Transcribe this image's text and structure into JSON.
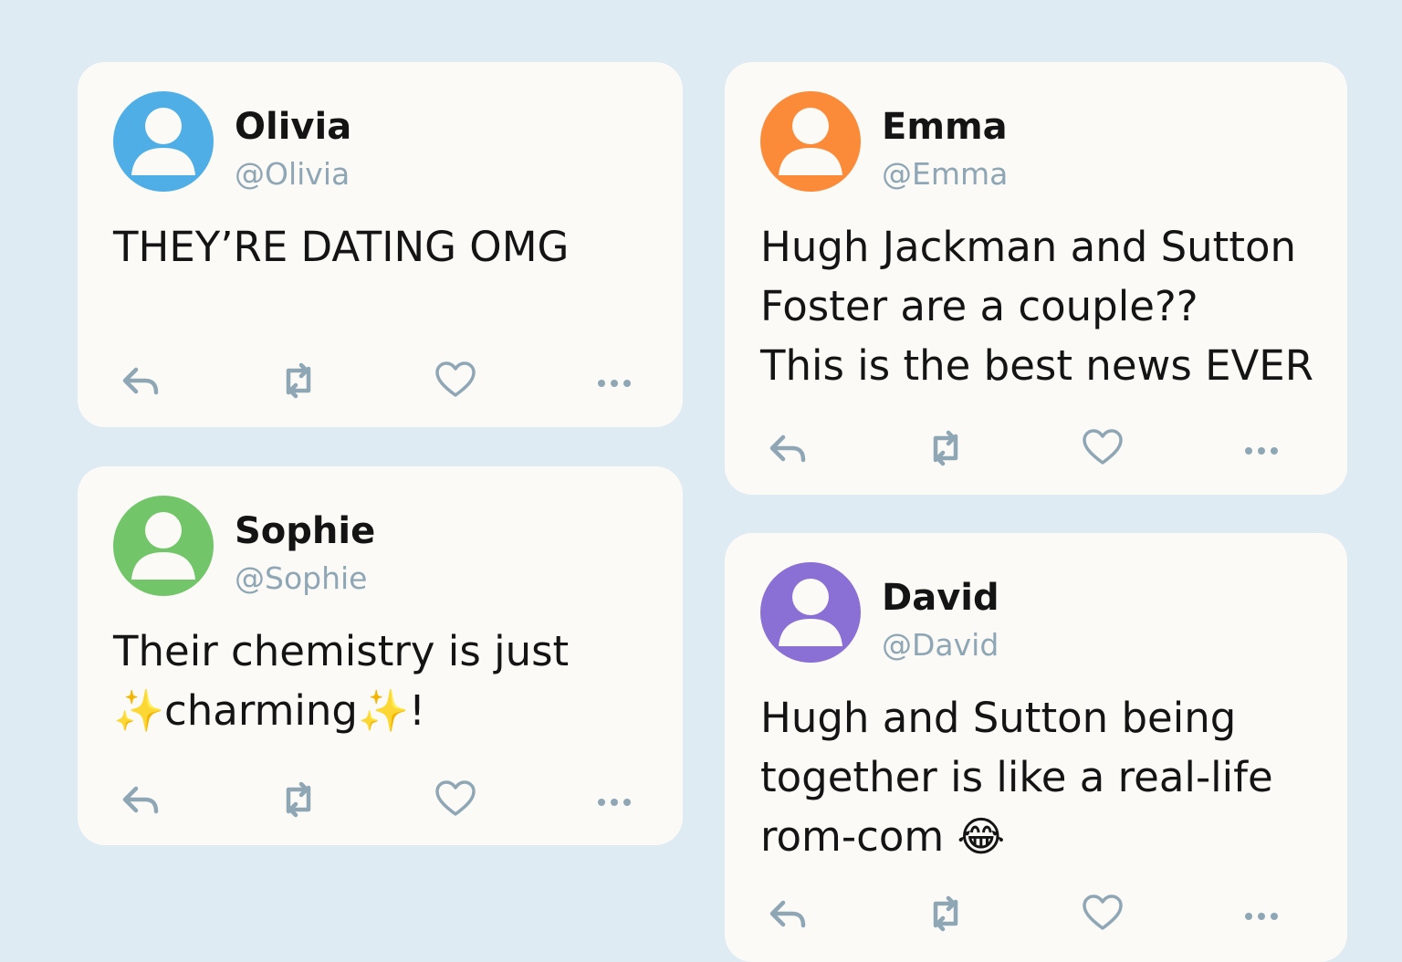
{
  "colors": {
    "background": "#deebf2",
    "card": "#fbfaf7",
    "icon": "#8fa7b5",
    "handle": "#8fa7b5"
  },
  "action_icons": [
    "reply-icon",
    "retweet-icon",
    "like-heart-icon",
    "more-options-icon"
  ],
  "tweets": [
    {
      "name": "Olivia",
      "handle": "@Olivia",
      "avatar_color": "#4faee6",
      "lines": [
        "THEY’RE DATING OMG"
      ]
    },
    {
      "name": "Emma",
      "handle": "@Emma",
      "avatar_color": "#fb8a39",
      "lines": [
        "Hugh Jackman and Sutton",
        "Foster are a couple??",
        "This is the best news EVER"
      ]
    },
    {
      "name": "Sophie",
      "handle": "@Sophie",
      "avatar_color": "#72c569",
      "lines": [
        "Their chemistry is just",
        "✨charming✨!"
      ]
    },
    {
      "name": "David",
      "handle": "@David",
      "avatar_color": "#8a6fd4",
      "lines": [
        "Hugh and Sutton being",
        "together is like a real-life",
        "rom-com 😂"
      ]
    }
  ]
}
